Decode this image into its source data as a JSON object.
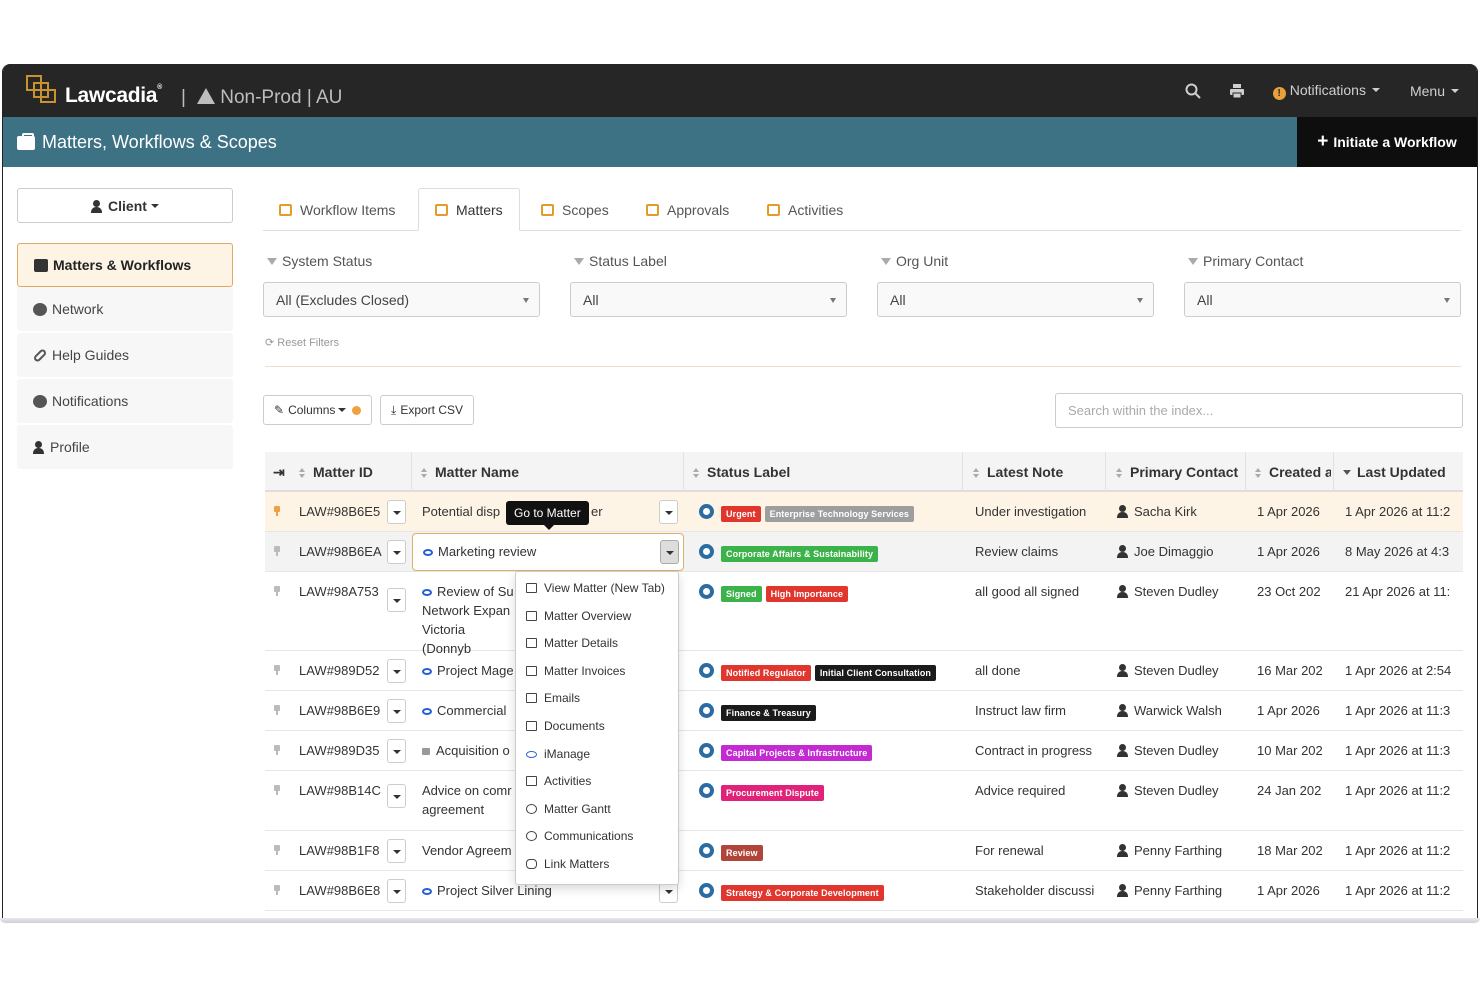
{
  "topbar": {
    "brand": "Lawcadia",
    "trademark": "®",
    "environment": "Non-Prod | AU",
    "notifications_label": "Notifications",
    "notifications_badge": "!",
    "menu_label": "Menu",
    "icons": [
      "search-icon",
      "print-icon"
    ]
  },
  "titlebar": {
    "title": "Matters, Workflows & Scopes",
    "initiate_label": "Initiate a Workflow"
  },
  "sidebar": {
    "client_label": "Client",
    "items": [
      {
        "label": "Matters & Workflows",
        "icon": "briefcase-icon",
        "active": true
      },
      {
        "label": "Network",
        "icon": "globe-icon"
      },
      {
        "label": "Help Guides",
        "icon": "link-icon"
      },
      {
        "label": "Notifications",
        "icon": "info-icon"
      },
      {
        "label": "Profile",
        "icon": "user-icon"
      }
    ]
  },
  "tabs": [
    {
      "label": "Workflow Items"
    },
    {
      "label": "Matters",
      "active": true
    },
    {
      "label": "Scopes"
    },
    {
      "label": "Approvals"
    },
    {
      "label": "Activities"
    }
  ],
  "filters": [
    {
      "label": "System Status",
      "value": "All (Excludes Closed)"
    },
    {
      "label": "Status Label",
      "value": "All"
    },
    {
      "label": "Org Unit",
      "value": "All"
    },
    {
      "label": "Primary Contact",
      "value": "All"
    }
  ],
  "reset_label": "Reset Filters",
  "toolbar": {
    "columns_label": "Columns",
    "export_label": "Export CSV",
    "search_placeholder": "Search within the index..."
  },
  "table": {
    "headers": {
      "matter_id": "Matter ID",
      "matter_name": "Matter Name",
      "status_label": "Status Label",
      "latest_note": "Latest Note",
      "primary_contact": "Primary Contact",
      "created": "Created a",
      "last_updated": "Last Updated"
    },
    "rows": [
      {
        "id": "LAW#98B6E5",
        "name": "Potential disp",
        "name_tail": "er",
        "note": "Under investigation",
        "contact": "Sacha Kirk",
        "created": "1 Apr 2026",
        "updated": "1 Apr 2026 at 11:2"
      },
      {
        "id": "LAW#98B6EA",
        "name": "Marketing review",
        "note": "Review claims",
        "contact": "Joe Dimaggio",
        "created": "1 Apr 2026",
        "updated": "8 May 2026 at 4:3"
      },
      {
        "id": "LAW#98A753",
        "name": "Review of Su",
        "name2": "Network Expan",
        "name3": "Victoria (Donnyb",
        "note": "all good all signed",
        "contact": "Steven Dudley",
        "created": "23 Oct 202",
        "updated": "21 Apr 2026 at 11:"
      },
      {
        "id": "LAW#989D52",
        "name": "Project Mage",
        "note": "all done",
        "contact": "Steven Dudley",
        "created": "16 Mar 202",
        "updated": "1 Apr 2026 at 2:54"
      },
      {
        "id": "LAW#98B6E9",
        "name": "Commercial",
        "note": "Instruct law firm",
        "contact": "Warwick Walsh",
        "created": "1 Apr 2026",
        "updated": "1 Apr 2026 at 11:3"
      },
      {
        "id": "LAW#989D35",
        "name": "Acquisition o",
        "note": "Contract in progress",
        "contact": "Steven Dudley",
        "created": "10 Mar 202",
        "updated": "1 Apr 2026 at 11:3"
      },
      {
        "id": "LAW#98B14C",
        "name": "Advice on comr",
        "name2": "agreement",
        "note": "Advice required",
        "contact": "Steven Dudley",
        "created": "24 Jan 202",
        "updated": "1 Apr 2026 at 11:2"
      },
      {
        "id": "LAW#98B1F8",
        "name": "Vendor Agreem",
        "note": "For renewal",
        "contact": "Penny Farthing",
        "created": "18 Mar 202",
        "updated": "1 Apr 2026 at 11:2"
      },
      {
        "id": "LAW#98B6E8",
        "name": "Project Silver Lining",
        "note": "Stakeholder discussi",
        "contact": "Penny Farthing",
        "created": "1 Apr 2026",
        "updated": "1 Apr 2026 at 11:2"
      }
    ],
    "labels": [
      [
        {
          "text": "Urgent",
          "color": "#e0362e"
        },
        {
          "text": "Enterprise Technology Services",
          "color": "#9e9e9e"
        }
      ],
      [
        {
          "text": "Corporate Affairs & Sustainability",
          "color": "#3cb34a"
        }
      ],
      [
        {
          "text": "Signed",
          "color": "#3cb34a"
        },
        {
          "text": "High Importance",
          "color": "#e0362e"
        }
      ],
      [
        {
          "text": "Notified Regulator",
          "color": "#e0362e"
        },
        {
          "text": "Initial Client Consultation",
          "color": "#1b1b1b"
        }
      ],
      [
        {
          "text": "Finance & Treasury",
          "color": "#1b1b1b"
        }
      ],
      [
        {
          "text": "Capital Projects & Infrastructure",
          "color": "#c32ad2"
        }
      ],
      [
        {
          "text": "Procurement Dispute",
          "color": "#e0227a"
        }
      ],
      [
        {
          "text": "Review",
          "color": "#b2453a"
        }
      ],
      [
        {
          "text": "Strategy & Corporate Development",
          "color": "#e0362e"
        }
      ]
    ]
  },
  "tooltip": "Go to Matter",
  "menu": {
    "items": [
      "View Matter (New Tab)",
      "Matter Overview",
      "Matter Details",
      "Matter Invoices",
      "Emails",
      "Documents",
      "iManage",
      "Activities",
      "Matter Gantt",
      "Communications",
      "Link Matters"
    ]
  },
  "colors": {
    "topbar": "#262626",
    "titlebar": "#3d7184",
    "accent": "#e49b2a",
    "highlight_row": "#fdf4e6"
  }
}
